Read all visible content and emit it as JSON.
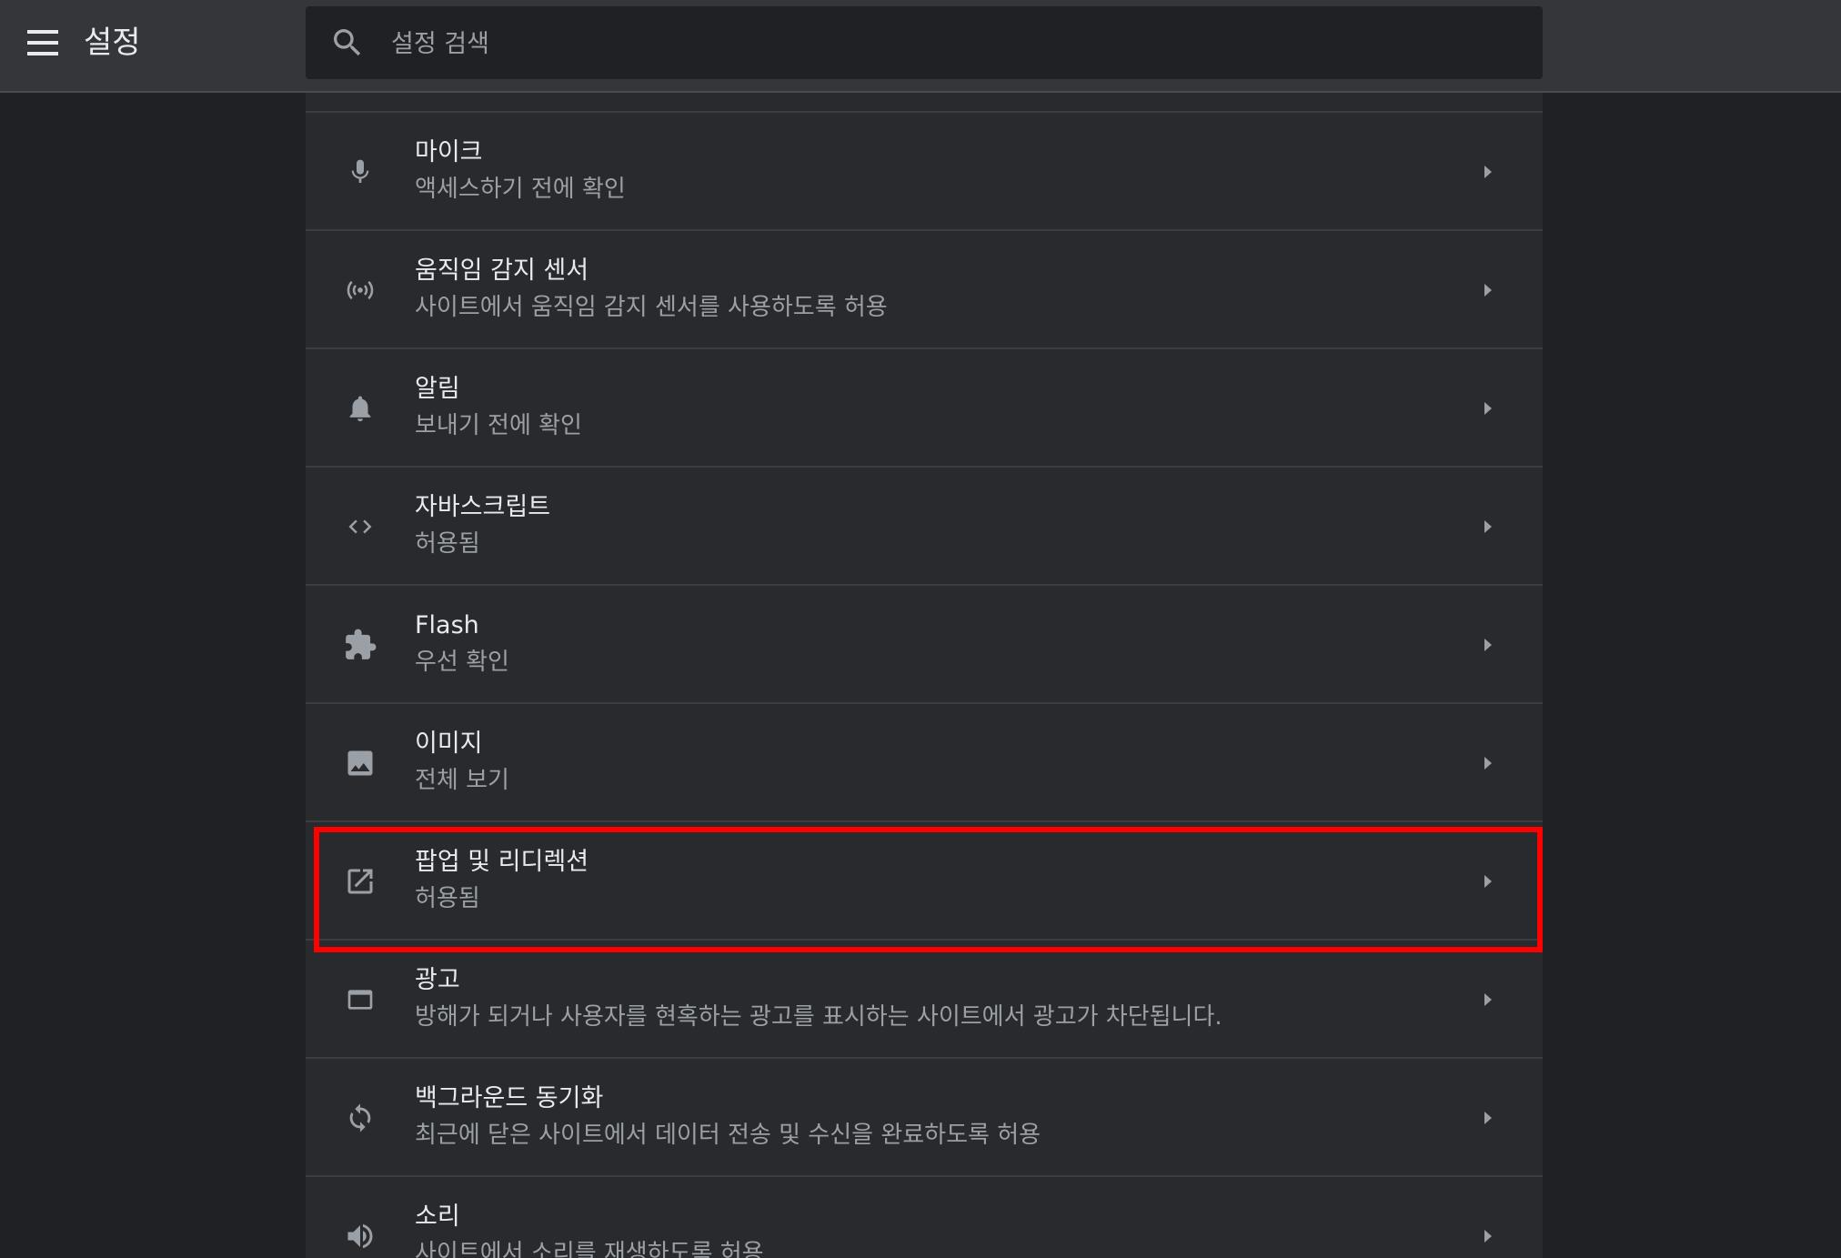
{
  "header": {
    "title": "설정",
    "search_placeholder": "설정 검색",
    "search_value": ""
  },
  "colors": {
    "background": "#202124",
    "toolbar": "#35363a",
    "card": "#292a2d",
    "text_primary": "#e8eaed",
    "text_secondary": "#9aa0a6",
    "highlight": "#ff0000"
  },
  "settings": [
    {
      "icon": "microphone-icon",
      "label": "마이크",
      "sub": "액세스하기 전에 확인"
    },
    {
      "icon": "motion-sensor-icon",
      "label": "움직임 감지 센서",
      "sub": "사이트에서 움직임 감지 센서를 사용하도록 허용"
    },
    {
      "icon": "bell-icon",
      "label": "알림",
      "sub": "보내기 전에 확인"
    },
    {
      "icon": "code-icon",
      "label": "자바스크립트",
      "sub": "허용됨"
    },
    {
      "icon": "puzzle-icon",
      "label": "Flash",
      "sub": "우선 확인"
    },
    {
      "icon": "image-icon",
      "label": "이미지",
      "sub": "전체 보기"
    },
    {
      "icon": "open-in-new-icon",
      "label": "팝업 및 리디렉션",
      "sub": "허용됨"
    },
    {
      "icon": "window-icon",
      "label": "광고",
      "sub": "방해가 되거나 사용자를 현혹하는 광고를 표시하는 사이트에서 광고가 차단됩니다."
    },
    {
      "icon": "sync-icon",
      "label": "백그라운드 동기화",
      "sub": "최근에 닫은 사이트에서 데이터 전송 및 수신을 완료하도록 허용"
    },
    {
      "icon": "speaker-icon",
      "label": "소리",
      "sub": "사이트에서 소리를 재생하도록 허용"
    }
  ]
}
